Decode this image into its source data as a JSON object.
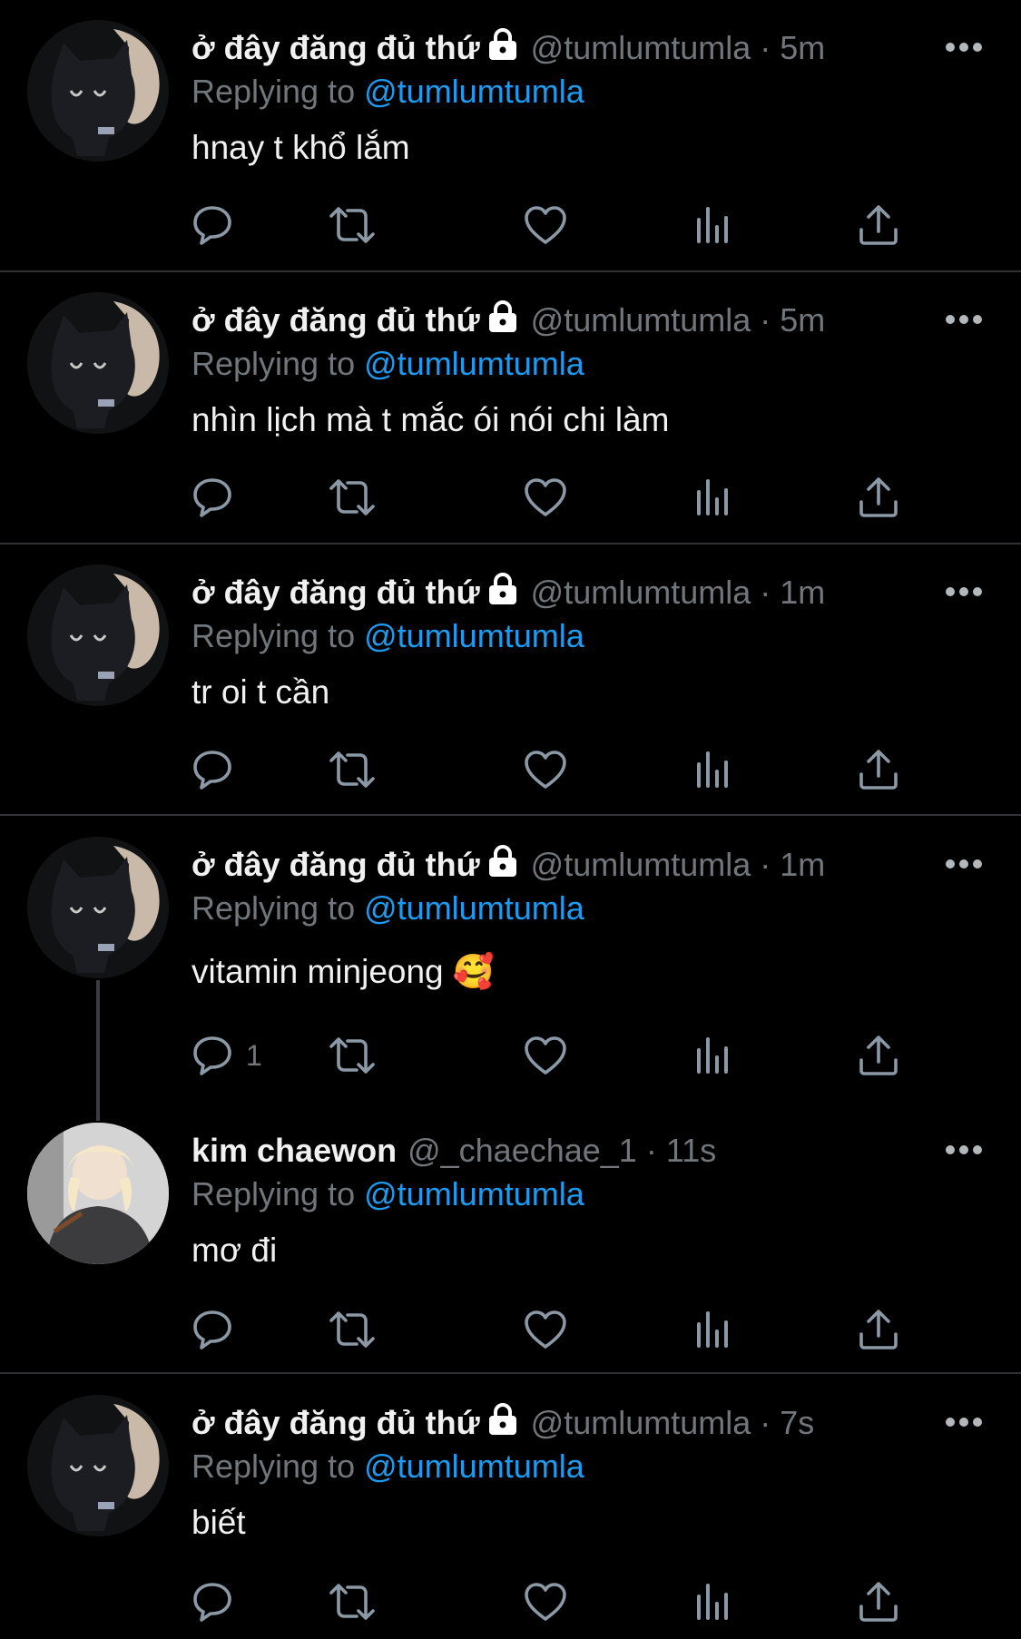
{
  "reply_prefix": "Replying to",
  "tweets": [
    {
      "name": "ở đây đăng đủ thứ",
      "handle": "@tumlumtumla",
      "time": "5m",
      "reply_to": "@tumlumtumla",
      "text": "hnay t khổ lắm",
      "reply_count": ""
    },
    {
      "name": "ở đây đăng đủ thứ",
      "handle": "@tumlumtumla",
      "time": "5m",
      "reply_to": "@tumlumtumla",
      "text": "nhìn lịch mà t mắc ói nói chi làm",
      "reply_count": ""
    },
    {
      "name": "ở đây đăng đủ thứ",
      "handle": "@tumlumtumla",
      "time": "1m",
      "reply_to": "@tumlumtumla",
      "text": "tr oi t cần",
      "reply_count": ""
    },
    {
      "name": "ở đây đăng đủ thứ",
      "handle": "@tumlumtumla",
      "time": "1m",
      "reply_to": "@tumlumtumla",
      "text": "vitamin minjeong 🥰",
      "reply_count": "1"
    },
    {
      "name": "kim chaewon",
      "handle": "@_chaechae_1",
      "time": "11s",
      "reply_to": "@tumlumtumla",
      "text": "mơ đi",
      "reply_count": ""
    },
    {
      "name": "ở đây đăng đủ thứ",
      "handle": "@tumlumtumla",
      "time": "7s",
      "reply_to": "@tumlumtumla",
      "text": "biết",
      "reply_count": ""
    }
  ],
  "colors": {
    "background": "#000000",
    "text": "#e7e9ea",
    "muted": "#71767b",
    "accent": "#1d9bf0",
    "divider": "#2f3336"
  },
  "icons": [
    "lock-icon",
    "more-icon",
    "reply-icon",
    "retweet-icon",
    "like-icon",
    "views-icon",
    "share-icon"
  ]
}
